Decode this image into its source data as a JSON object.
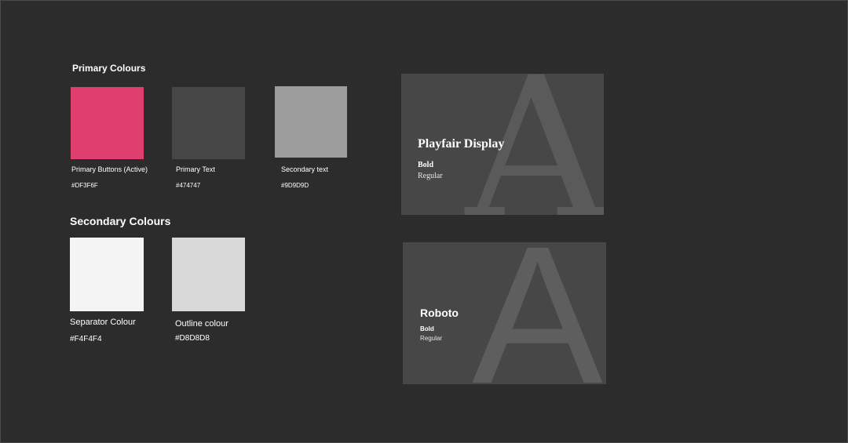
{
  "primary_colours": {
    "title": "Primary Colours",
    "swatches": [
      {
        "label": "Primary Buttons (Active)",
        "hex": "#DF3F6F",
        "color": "#DF3F6F"
      },
      {
        "label": "Primary Text",
        "hex": "#474747",
        "color": "#474747"
      },
      {
        "label": "Secondary text",
        "hex": "#9D9D9D",
        "color": "#9D9D9D"
      }
    ]
  },
  "secondary_colours": {
    "title": "Secondary Colours",
    "swatches": [
      {
        "label": "Separator Colour",
        "hex": "#F4F4F4",
        "color": "#F4F4F4"
      },
      {
        "label": "Outline colour",
        "hex": "#D8D8D8",
        "color": "#D8D8D8"
      }
    ]
  },
  "fonts": [
    {
      "letter": "A",
      "name": "Playfair Display",
      "bold": "Bold",
      "regular": "Regular"
    },
    {
      "letter": "A",
      "name": "Roboto",
      "bold": "Bold",
      "regular": "Regular"
    }
  ]
}
